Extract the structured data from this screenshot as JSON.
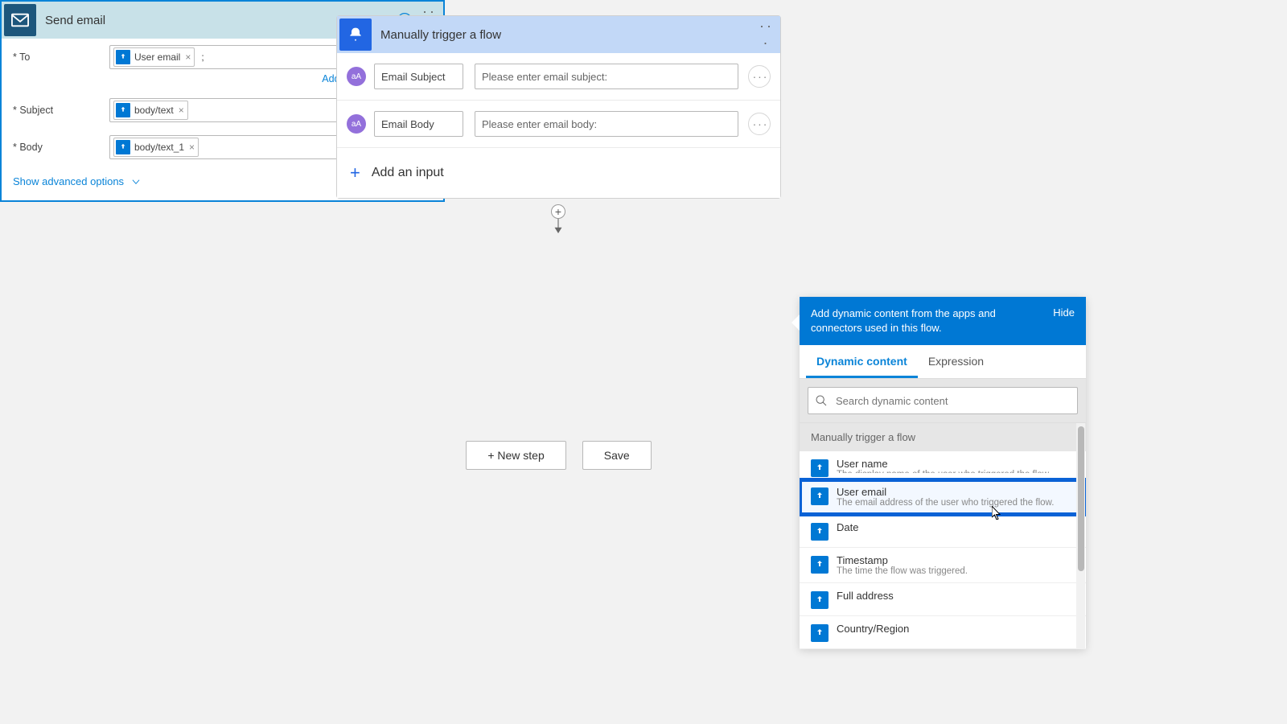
{
  "trigger": {
    "title": "Manually trigger a flow",
    "inputs": [
      {
        "name": "Email Subject",
        "prompt": "Please enter email subject:"
      },
      {
        "name": "Email Body",
        "prompt": "Please enter email body:"
      }
    ],
    "add_input_label": "Add an input"
  },
  "email": {
    "title": "Send email",
    "fields": {
      "to": {
        "label": "To",
        "token": "User email",
        "after": ";"
      },
      "subject": {
        "label": "Subject",
        "token": "body/text"
      },
      "body": {
        "label": "Body",
        "token": "body/text_1"
      }
    },
    "add_dynamic_label": "Add dynamic content",
    "advanced_label": "Show advanced options"
  },
  "buttons": {
    "new_step": "+ New step",
    "save": "Save"
  },
  "dc_panel": {
    "header_text": "Add dynamic content from the apps and connectors used in this flow.",
    "hide_label": "Hide",
    "tabs": {
      "dynamic": "Dynamic content",
      "expression": "Expression"
    },
    "search_placeholder": "Search dynamic content",
    "group_label": "Manually trigger a flow",
    "items": [
      {
        "title": "User name",
        "desc": "The display name of the user who triggered the flow"
      },
      {
        "title": "User email",
        "desc": "The email address of the user who triggered the flow."
      },
      {
        "title": "Date",
        "desc": ""
      },
      {
        "title": "Timestamp",
        "desc": "The time the flow was triggered."
      },
      {
        "title": "Full address",
        "desc": ""
      },
      {
        "title": "Country/Region",
        "desc": ""
      }
    ]
  }
}
